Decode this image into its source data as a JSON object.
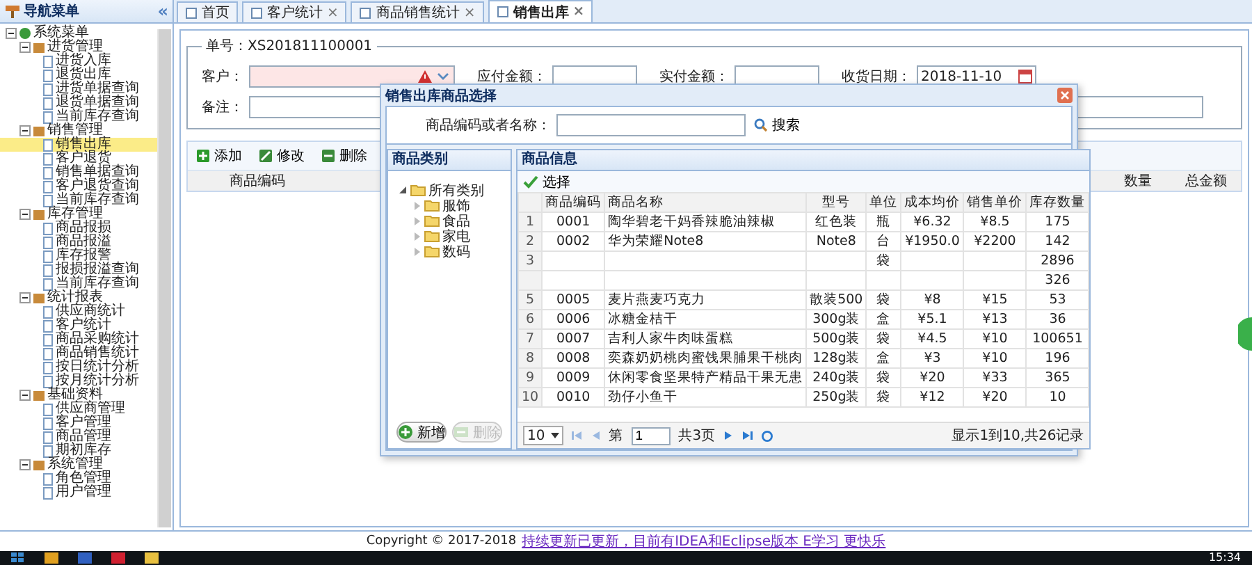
{
  "sidebar": {
    "title": "导航菜单",
    "collapse": "«",
    "tree": [
      {
        "label": "系统菜单",
        "expanded": true,
        "children": [
          {
            "label": "进货管理",
            "expanded": true,
            "children": [
              {
                "label": "进货入库",
                "selected": false
              },
              {
                "label": "退货出库",
                "selected": false
              },
              {
                "label": "进货单据查询",
                "selected": false
              },
              {
                "label": "退货单据查询",
                "selected": false
              },
              {
                "label": "当前库存查询",
                "selected": false
              }
            ]
          },
          {
            "label": "销售管理",
            "expanded": true,
            "children": [
              {
                "label": "销售出库",
                "selected": true
              },
              {
                "label": "客户退货",
                "selected": false
              },
              {
                "label": "销售单据查询",
                "selected": false
              },
              {
                "label": "客户退货查询",
                "selected": false
              },
              {
                "label": "当前库存查询",
                "selected": false
              }
            ]
          },
          {
            "label": "库存管理",
            "expanded": true,
            "children": [
              {
                "label": "商品报损",
                "selected": false
              },
              {
                "label": "商品报溢",
                "selected": false
              },
              {
                "label": "库存报警",
                "selected": false
              },
              {
                "label": "报损报溢查询",
                "selected": false
              },
              {
                "label": "当前库存查询",
                "selected": false
              }
            ]
          },
          {
            "label": "统计报表",
            "expanded": true,
            "children": [
              {
                "label": "供应商统计",
                "selected": false
              },
              {
                "label": "客户统计",
                "selected": false
              },
              {
                "label": "商品采购统计",
                "selected": false
              },
              {
                "label": "商品销售统计",
                "selected": false
              },
              {
                "label": "按日统计分析",
                "selected": false
              },
              {
                "label": "按月统计分析",
                "selected": false
              }
            ]
          },
          {
            "label": "基础资料",
            "expanded": true,
            "children": [
              {
                "label": "供应商管理",
                "selected": false
              },
              {
                "label": "客户管理",
                "selected": false
              },
              {
                "label": "商品管理",
                "selected": false
              },
              {
                "label": "期初库存",
                "selected": false
              }
            ]
          },
          {
            "label": "系统管理",
            "expanded": true,
            "children": [
              {
                "label": "角色管理",
                "selected": false
              },
              {
                "label": "用户管理",
                "selected": false
              }
            ]
          }
        ]
      }
    ]
  },
  "tabs": [
    {
      "label": "首页",
      "selected": false
    },
    {
      "label": "客户统计",
      "close": "×",
      "selected": false
    },
    {
      "label": "商品销售统计",
      "close": "×",
      "selected": false
    },
    {
      "label": "销售出库",
      "close": "×",
      "selected": true
    }
  ],
  "form": {
    "legend": "单号：XS201811100001",
    "fields": [
      {
        "kind": "combo",
        "label": "客户：",
        "invalid": true
      },
      {
        "kind": "text",
        "label": "应付金额："
      },
      {
        "kind": "text",
        "label": "实付金额："
      },
      {
        "kind": "date",
        "label": "收货日期：",
        "value": "2018-11-10"
      }
    ],
    "remark": {
      "label": "备注："
    }
  },
  "toolbar": [
    {
      "kind": "add",
      "label": "添加",
      "disabled": false
    },
    {
      "kind": "edit",
      "label": "修改",
      "disabled": false
    },
    {
      "kind": "delete",
      "label": "删除",
      "disabled": false
    }
  ],
  "grid": {
    "columns": [
      {
        "label": "商品编码"
      },
      {
        "label": "数量"
      },
      {
        "label": "总金额"
      }
    ]
  },
  "dialog": {
    "title": "销售出库商品选择",
    "search_label": "商品编码或者名称：",
    "search_button": "搜索",
    "category": {
      "title": "商品类别",
      "root": {
        "label": "所有类别",
        "expanded": true,
        "children": [
          {
            "label": "服饰",
            "expanded": false
          },
          {
            "label": "食品",
            "expanded": false
          },
          {
            "label": "家电",
            "expanded": false
          },
          {
            "label": "数码",
            "expanded": false
          }
        ]
      },
      "buttons": [
        {
          "kind": "add",
          "label": "新增",
          "disabled": false
        },
        {
          "kind": "delete",
          "label": "删除",
          "disabled": true
        }
      ]
    },
    "goods": {
      "title": "商品信息",
      "select_button": "选择",
      "columns": [
        "商品编码",
        "商品名称",
        "型号",
        "单位",
        "成本均价",
        "销售单价",
        "库存数量"
      ],
      "rows": [
        {
          "no": "1",
          "code": "0001",
          "name": "陶华碧老干妈香辣脆油辣椒",
          "type": "红色装",
          "unit": "瓶",
          "cost": "¥6.32",
          "price": "¥8.5",
          "stock": "175"
        },
        {
          "no": "2",
          "code": "0002",
          "name": "华为荣耀Note8",
          "type": "Note8",
          "unit": "台",
          "cost": "¥1950.0",
          "price": "¥2200",
          "stock": "142"
        },
        {
          "no": "3",
          "unit": "袋",
          "stock": "2896"
        },
        {
          "stock": "326"
        },
        {
          "no": "5",
          "code": "0005",
          "name": "麦片燕麦巧克力",
          "type": "散装500",
          "unit": "袋",
          "cost": "¥8",
          "price": "¥15",
          "stock": "53"
        },
        {
          "no": "6",
          "code": "0006",
          "name": "冰糖金桔干",
          "type": "300g装",
          "unit": "盒",
          "cost": "¥5.1",
          "price": "¥13",
          "stock": "36"
        },
        {
          "no": "7",
          "code": "0007",
          "name": "吉利人家牛肉味蛋糕",
          "type": "500g装",
          "unit": "袋",
          "cost": "¥4.5",
          "price": "¥10",
          "stock": "100651"
        },
        {
          "no": "8",
          "code": "0008",
          "name": "奕森奶奶桃肉蜜饯果脯果干桃肉",
          "type": "128g装",
          "unit": "盒",
          "cost": "¥3",
          "price": "¥10",
          "stock": "196"
        },
        {
          "no": "9",
          "code": "0009",
          "name": "休闲零食坚果特产精品干果无患",
          "type": "240g装",
          "unit": "袋",
          "cost": "¥20",
          "price": "¥33",
          "stock": "365"
        },
        {
          "no": "10",
          "code": "0010",
          "name": "劲仔小鱼干",
          "type": "250g装",
          "unit": "袋",
          "cost": "¥12",
          "price": "¥20",
          "stock": "10"
        }
      ],
      "pager": {
        "page_size": "10",
        "page_label": "第",
        "page": "1",
        "pages": "共3页",
        "summary": "显示1到10,共26记录"
      }
    }
  },
  "footer": {
    "text": "Copyright © 2017-2018",
    "link": "持续更新已更新，目前有IDEA和Eclipse版本 E学习 更快乐"
  },
  "taskbar": {
    "time": "15:34"
  }
}
